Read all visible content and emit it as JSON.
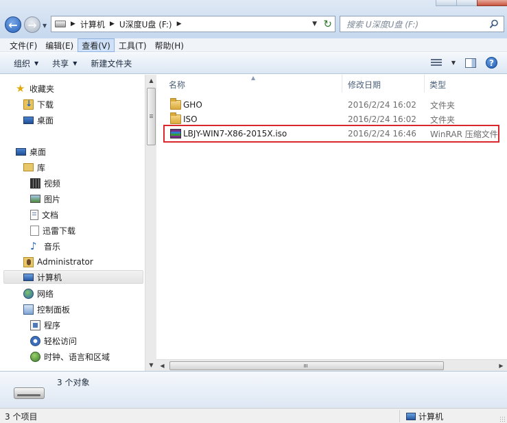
{
  "window": {
    "controls": [
      "minimize",
      "maximize",
      "close"
    ]
  },
  "navigation": {
    "breadcrumb": [
      "计算机",
      "U深度U盘 (F:)"
    ],
    "search_placeholder": "搜索 U深度U盘 (F:)"
  },
  "menubar": {
    "items": [
      "文件(F)",
      "编辑(E)",
      "查看(V)",
      "工具(T)",
      "帮助(H)"
    ],
    "active_index": 2
  },
  "toolbar": {
    "organize": "组织",
    "share": "共享",
    "new_folder": "新建文件夹"
  },
  "sidebar": {
    "items": [
      {
        "label": "收藏夹",
        "icon": "star-icon"
      },
      {
        "label": "下载",
        "icon": "downloads-folder-icon"
      },
      {
        "label": "桌面",
        "icon": "desktop-icon"
      },
      {
        "label": "桌面",
        "icon": "desktop-icon"
      },
      {
        "label": "库",
        "icon": "library-icon"
      },
      {
        "label": "视频",
        "icon": "video-icon"
      },
      {
        "label": "图片",
        "icon": "pictures-icon"
      },
      {
        "label": "文档",
        "icon": "documents-icon"
      },
      {
        "label": "迅雷下载",
        "icon": "xunlei-download-icon"
      },
      {
        "label": "音乐",
        "icon": "music-icon"
      },
      {
        "label": "Administrator",
        "icon": "user-folder-icon"
      },
      {
        "label": "计算机",
        "icon": "computer-icon",
        "selected": true
      },
      {
        "label": "网络",
        "icon": "network-icon"
      },
      {
        "label": "控制面板",
        "icon": "control-panel-icon"
      },
      {
        "label": "程序",
        "icon": "programs-icon"
      },
      {
        "label": "轻松访问",
        "icon": "ease-of-access-icon"
      },
      {
        "label": "时钟、语言和区域",
        "icon": "clock-language-region-icon"
      }
    ]
  },
  "file_list": {
    "columns": [
      "名称",
      "修改日期",
      "类型"
    ],
    "rows": [
      {
        "name": "GHO",
        "date": "2016/2/24 16:02",
        "type": "文件夹",
        "icon": "folder-icon"
      },
      {
        "name": "ISO",
        "date": "2016/2/24 16:02",
        "type": "文件夹",
        "icon": "folder-icon"
      },
      {
        "name": "LBJY-WIN7-X86-2015X.iso",
        "date": "2016/2/24 16:46",
        "type": "WinRAR 压缩文件",
        "icon": "winrar-archive-icon",
        "highlighted": true
      }
    ]
  },
  "details": {
    "object_count": "3 个对象"
  },
  "statusbar": {
    "item_count": "3 个项目",
    "location": "计算机"
  },
  "colors": {
    "highlight_border": "#d9262a",
    "menu_active_bg": "#cfe1f8"
  }
}
